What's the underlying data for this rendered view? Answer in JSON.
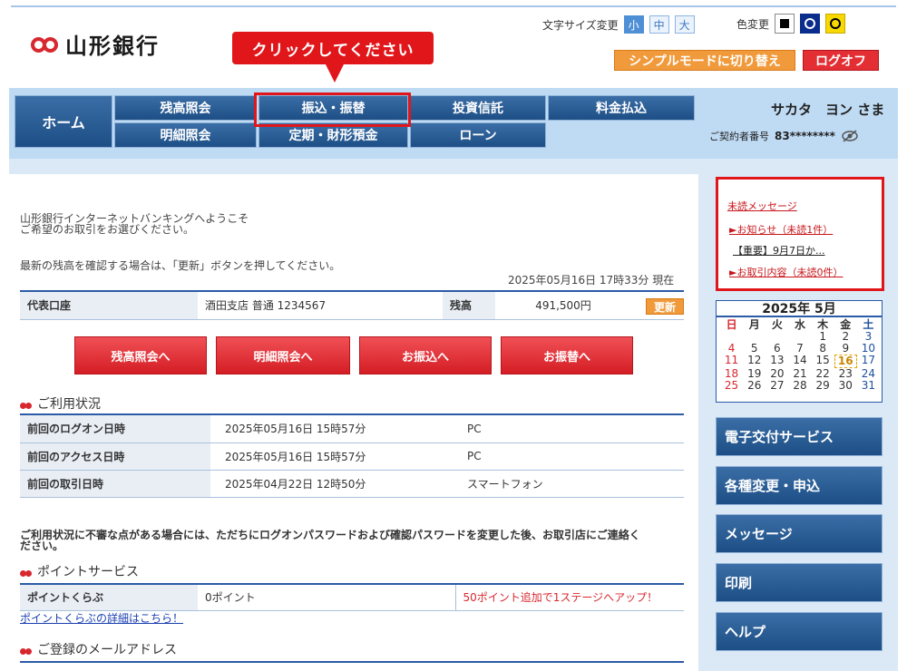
{
  "header": {
    "logo_text": "山形銀行",
    "callout": "クリックしてください",
    "font_size_label": "文字サイズ変更",
    "font_sizes": [
      "小",
      "中",
      "大"
    ],
    "color_change_label": "色変更",
    "simple_mode": "シンプルモードに切り替え",
    "logoff": "ログオフ"
  },
  "nav": {
    "home": "ホーム",
    "row1": [
      "残高照会",
      "振込・振替",
      "投資信託",
      "料金払込"
    ],
    "row2": [
      "明細照会",
      "定期・財形預金",
      "ローン"
    ],
    "user_name": "サカタ　ヨン さま",
    "contract_label": "ご契約者番号",
    "contract_number": "83********"
  },
  "main": {
    "welcome_line1": "山形銀行インターネットバンキングへようこそ",
    "welcome_line2": "ご希望のお取引をお選びください。",
    "refresh_hint": "最新の残高を確認する場合は、「更新」ボタンを押してください。",
    "as_of": "2025年05月16日 17時33分 現在",
    "account": {
      "label": "代表口座",
      "branch": "酒田支店 普通 1234567",
      "balance_label": "残高",
      "balance": "491,500円",
      "update_button": "更新"
    },
    "action_buttons": [
      "残高照会へ",
      "明細照会へ",
      "お振込へ",
      "お振替へ"
    ],
    "usage_title": "ご利用状況",
    "usage_rows": [
      {
        "label": "前回のログオン日時",
        "datetime": "2025年05月16日 15時57分",
        "device": "PC"
      },
      {
        "label": "前回のアクセス日時",
        "datetime": "2025年05月16日 15時57分",
        "device": "PC"
      },
      {
        "label": "前回の取引日時",
        "datetime": "2025年04月22日 12時50分",
        "device": "スマートフォン"
      }
    ],
    "warning_line1": "ご利用状況に不審な点がある場合には、ただちにログオンパスワードおよび確認パスワードを変更した後、お取引店にご連絡く",
    "warning_line2": "ださい。",
    "points_title": "ポイントサービス",
    "points": {
      "label": "ポイントくらぶ",
      "value": "0ポイント",
      "promo": "50ポイント追加で1ステージへアップ！",
      "link": "ポイントくらぶの詳細はこちら！"
    },
    "email_title": "ご登録のメールアドレス"
  },
  "messages": {
    "unread_title": "未読メッセージ",
    "notice": "►お知らせ（未読1件）",
    "notice_item": "【重要】9月7日か...",
    "transactions": "►お取引内容（未読0件）"
  },
  "calendar": {
    "title": "2025年 5月",
    "weekdays": [
      "日",
      "月",
      "火",
      "水",
      "木",
      "金",
      "土"
    ],
    "days": [
      "",
      "",
      "",
      "",
      "1",
      "2",
      "3",
      "4",
      "5",
      "6",
      "7",
      "8",
      "9",
      "10",
      "11",
      "12",
      "13",
      "14",
      "15",
      "16",
      "17",
      "18",
      "19",
      "20",
      "21",
      "22",
      "23",
      "24",
      "25",
      "26",
      "27",
      "28",
      "29",
      "30",
      "31"
    ],
    "today": "16"
  },
  "side_buttons": [
    "電子交付サービス",
    "各種変更・申込",
    "メッセージ",
    "印刷",
    "ヘルプ"
  ]
}
